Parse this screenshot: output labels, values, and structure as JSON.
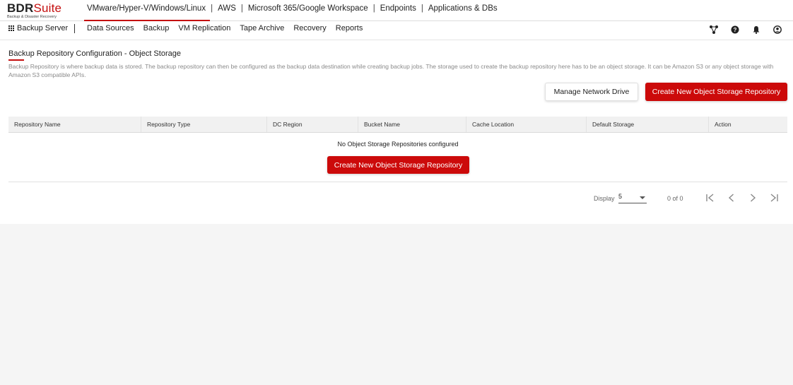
{
  "logo": {
    "brand_main": "BDR",
    "brand_suite": "Suite",
    "tagline": "Backup & Disaster Recovery"
  },
  "product_nav": [
    {
      "label": "VMware/Hyper-V/Windows/Linux",
      "active": true
    },
    {
      "label": "AWS"
    },
    {
      "label": "Microsoft 365/Google Workspace"
    },
    {
      "label": "Endpoints"
    },
    {
      "label": "Applications & DBs"
    }
  ],
  "separator": "|",
  "server": {
    "label": "Backup Server",
    "icon": "grid-icon"
  },
  "main_nav": [
    "Data Sources",
    "Backup",
    "VM Replication",
    "Tape Archive",
    "Recovery",
    "Reports"
  ],
  "header_icons": [
    "network-icon",
    "help-icon",
    "bell-icon",
    "user-icon"
  ],
  "page": {
    "title": "Backup Repository Configuration - Object Storage",
    "description": "Backup Repository is where backup data is stored. The backup repository can then be configured as the backup data destination while creating backup jobs. The storage used to create the backup repository here has to be an object storage. It can be Amazon S3 or any object storage with Amazon S3 compatible APIs."
  },
  "buttons": {
    "manage_network_drive": "Manage Network Drive",
    "create_repository": "Create New Object Storage Repository"
  },
  "table": {
    "columns": [
      "Repository Name",
      "Repository Type",
      "DC Region",
      "Bucket Name",
      "Cache Location",
      "Default Storage",
      "Action"
    ],
    "empty_message": "No Object Storage Repositories configured"
  },
  "pagination": {
    "display_label": "Display",
    "page_size": "5",
    "count": "0 of 0"
  },
  "colors": {
    "accent": "#cc0a0a"
  }
}
